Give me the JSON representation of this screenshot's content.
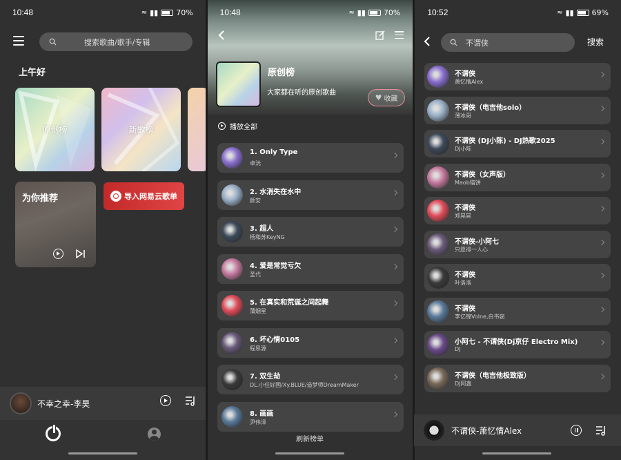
{
  "phone1": {
    "status": {
      "time": "10:48",
      "battery": "70%"
    },
    "search_placeholder": "搜索歌曲/歌手/专辑",
    "greeting": "上午好",
    "cards": [
      {
        "label": "原创榜"
      },
      {
        "label": "新歌榜"
      }
    ],
    "recommend_title": "为你推荐",
    "import_label": "导入网易云歌单",
    "now_playing": "不幸之幸-李昊"
  },
  "phone2": {
    "status": {
      "time": "10:48",
      "battery": "70%"
    },
    "chart_title": "原创榜",
    "chart_desc": "大家都在听的原创歌曲",
    "fav_label": "收藏",
    "play_all": "播放全部",
    "songs": [
      {
        "name": "1. Only Type",
        "artist": "卓沅"
      },
      {
        "name": "2. 水消失在水中",
        "artist": "颜安"
      },
      {
        "name": "3. 超人",
        "artist": "杨和苏KeyNG"
      },
      {
        "name": "4. 爱是常觉亏欠",
        "artist": "圣代"
      },
      {
        "name": "5. 在真实和荒诞之间起舞",
        "artist": "蒲烟星"
      },
      {
        "name": "6. 坏心情0105",
        "artist": "程思源"
      },
      {
        "name": "7. 双生劫",
        "artist": "DL.小任好困/Xy.BLUE/造梦师DreamMaker"
      },
      {
        "name": "8. 画画",
        "artist": "尹伟泽"
      }
    ],
    "refresh_label": "刷新榜单"
  },
  "phone3": {
    "status": {
      "time": "10:52",
      "battery": "69%"
    },
    "search_value": "不谓侠",
    "search_button": "搜索",
    "results": [
      {
        "name": "不谓侠",
        "artist": "萧忆情Alex"
      },
      {
        "name": "不谓侠（电吉他solo）",
        "artist": "薄冰哥"
      },
      {
        "name": "不谓侠 (DJ小陈) - DJ热歌2025",
        "artist": "DJ小陈"
      },
      {
        "name": "不谓侠（女声版）",
        "artist": "Maob猫饼"
      },
      {
        "name": "不谓侠",
        "artist": "郑晃晃"
      },
      {
        "name": "不谓侠-小阿七",
        "artist": "只愿得一人心"
      },
      {
        "name": "不谓侠",
        "artist": "叶洛洛"
      },
      {
        "name": "不谓侠",
        "artist": "李亿锦Volne,白书窈"
      },
      {
        "name": "小阿七 - 不谓侠(Dj京仔 Electro Mix)",
        "artist": "DJ"
      },
      {
        "name": "不谓侠（电吉他极致版）",
        "artist": "DJ阿鑫"
      }
    ],
    "now_playing": "不谓侠-萧忆情Alex"
  },
  "colors": {
    "accent_red": "#d93b3b",
    "bg": "#303030",
    "row_bg": "#444444"
  }
}
